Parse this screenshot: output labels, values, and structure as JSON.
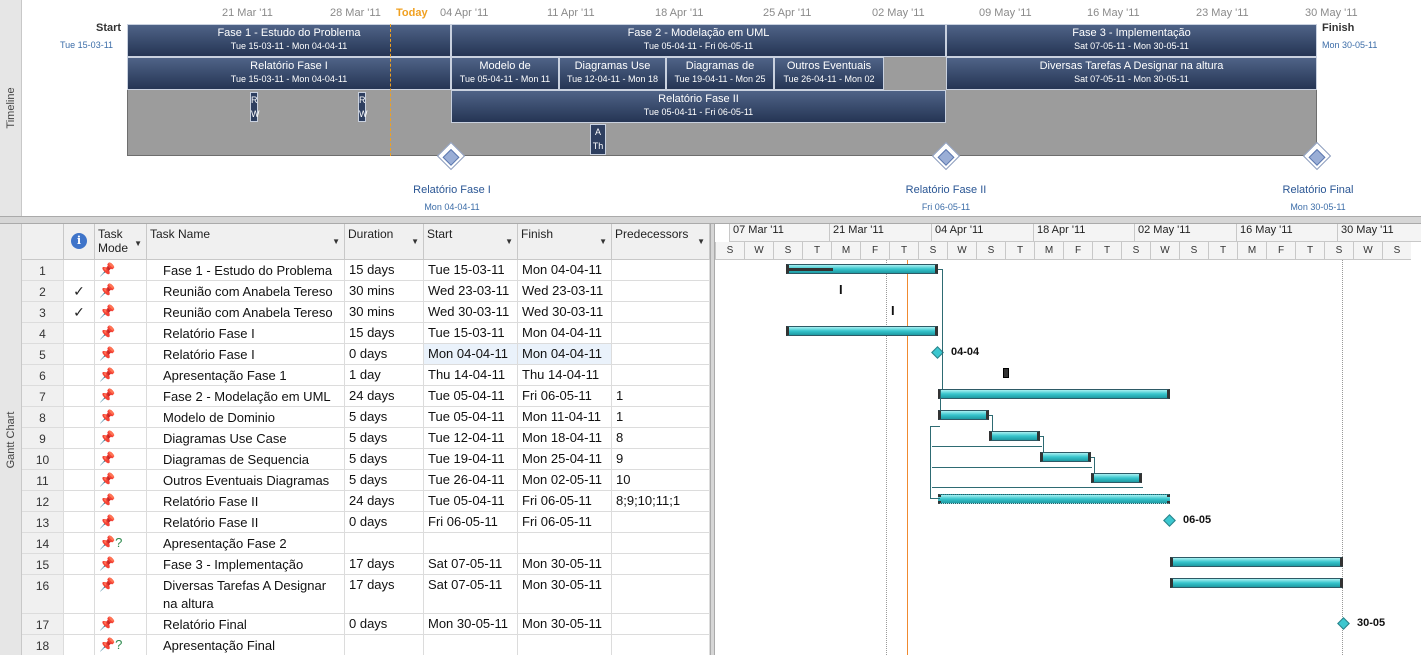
{
  "side_labels": {
    "timeline": "Timeline",
    "gantt": "Gantt Chart"
  },
  "timeline": {
    "axis": [
      "21 Mar '11",
      "28 Mar '11",
      "Today",
      "04 Apr '11",
      "11 Apr '11",
      "18 Apr '11",
      "25 Apr '11",
      "02 May '11",
      "09 May '11",
      "16 May '11",
      "23 May '11",
      "30 May '11"
    ],
    "start": {
      "label": "Start",
      "date": "Tue 15-03-11"
    },
    "finish": {
      "label": "Finish",
      "date": "Mon 30-05-11"
    },
    "bars": [
      {
        "name": "Fase 1 - Estudo do Problema",
        "dates": "Tue 15-03-11 - Mon 04-04-11"
      },
      {
        "name": "Fase 2 - Modelação em UML",
        "dates": "Tue 05-04-11 - Fri 06-05-11"
      },
      {
        "name": "Fase 3 - Implementação",
        "dates": "Sat 07-05-11 - Mon 30-05-11"
      },
      {
        "name": "Relatório Fase I",
        "dates": "Tue 15-03-11 - Mon 04-04-11"
      },
      {
        "name": "Modelo de",
        "dates": "Tue 05-04-11 - Mon 11"
      },
      {
        "name": "Diagramas Use",
        "dates": "Tue 12-04-11 - Mon 18"
      },
      {
        "name": "Diagramas de",
        "dates": "Tue 19-04-11 - Mon 25"
      },
      {
        "name": "Outros Eventuais",
        "dates": "Tue 26-04-11 - Mon 02"
      },
      {
        "name": "Diversas Tarefas A Designar na altura",
        "dates": "Sat 07-05-11 - Mon 30-05-11"
      },
      {
        "name": "Relatório Fase II",
        "dates": "Tue 05-04-11 - Fri 06-05-11"
      }
    ],
    "small_tasks": [
      {
        "t1": "R",
        "t2": "W"
      },
      {
        "t1": "R",
        "t2": "W"
      },
      {
        "t1": "A",
        "t2": "Th"
      }
    ],
    "milestones": [
      {
        "name": "Relatório Fase I",
        "date": "Mon 04-04-11"
      },
      {
        "name": "Relatório Fase II",
        "date": "Fri 06-05-11"
      },
      {
        "name": "Relatório Final",
        "date": "Mon 30-05-11"
      }
    ]
  },
  "table": {
    "headers": {
      "indicators": "i",
      "mode": "Task Mode",
      "name": "Task Name",
      "duration": "Duration",
      "start": "Start",
      "finish": "Finish",
      "predecessors": "Predecessors"
    },
    "rows": [
      {
        "id": "1",
        "check": "",
        "mode": "auto",
        "name": "Fase 1 - Estudo do Problema",
        "duration": "15 days",
        "start": "Tue 15-03-11",
        "finish": "Mon 04-04-11",
        "pred": ""
      },
      {
        "id": "2",
        "check": "✓",
        "mode": "auto",
        "name": "Reunião com Anabela Tereso",
        "duration": "30 mins",
        "start": "Wed 23-03-11",
        "finish": "Wed 23-03-11",
        "pred": ""
      },
      {
        "id": "3",
        "check": "✓",
        "mode": "auto",
        "name": "Reunião com Anabela Tereso",
        "duration": "30 mins",
        "start": "Wed 30-03-11",
        "finish": "Wed 30-03-11",
        "pred": ""
      },
      {
        "id": "4",
        "check": "",
        "mode": "auto",
        "name": "Relatório Fase I",
        "duration": "15 days",
        "start": "Tue 15-03-11",
        "finish": "Mon 04-04-11",
        "pred": ""
      },
      {
        "id": "5",
        "check": "",
        "mode": "auto",
        "name": "Relatório Fase I",
        "duration": "0 days",
        "start": "Mon 04-04-11",
        "finish": "Mon 04-04-11",
        "pred": ""
      },
      {
        "id": "6",
        "check": "",
        "mode": "auto",
        "name": "Apresentação Fase 1",
        "duration": "1 day",
        "start": "Thu 14-04-11",
        "finish": "Thu 14-04-11",
        "pred": ""
      },
      {
        "id": "7",
        "check": "",
        "mode": "auto",
        "name": "Fase 2 - Modelação em UML",
        "duration": "24 days",
        "start": "Tue 05-04-11",
        "finish": "Fri 06-05-11",
        "pred": "1"
      },
      {
        "id": "8",
        "check": "",
        "mode": "auto",
        "name": "Modelo de Dominio",
        "duration": "5 days",
        "start": "Tue 05-04-11",
        "finish": "Mon 11-04-11",
        "pred": "1"
      },
      {
        "id": "9",
        "check": "",
        "mode": "auto",
        "name": "Diagramas Use Case",
        "duration": "5 days",
        "start": "Tue 12-04-11",
        "finish": "Mon 18-04-11",
        "pred": "8"
      },
      {
        "id": "10",
        "check": "",
        "mode": "auto",
        "name": "Diagramas de Sequencia",
        "duration": "5 days",
        "start": "Tue 19-04-11",
        "finish": "Mon 25-04-11",
        "pred": "9"
      },
      {
        "id": "11",
        "check": "",
        "mode": "auto",
        "name": "Outros Eventuais Diagramas",
        "duration": "5 days",
        "start": "Tue 26-04-11",
        "finish": "Mon 02-05-11",
        "pred": "10"
      },
      {
        "id": "12",
        "check": "",
        "mode": "auto",
        "name": "Relatório Fase II",
        "duration": "24 days",
        "start": "Tue 05-04-11",
        "finish": "Fri 06-05-11",
        "pred": "8;9;10;11;1"
      },
      {
        "id": "13",
        "check": "",
        "mode": "auto",
        "name": "Relatório Fase II",
        "duration": "0 days",
        "start": "Fri 06-05-11",
        "finish": "Fri 06-05-11",
        "pred": ""
      },
      {
        "id": "14",
        "check": "",
        "mode": "manual",
        "name": "Apresentação Fase 2",
        "duration": "",
        "start": "",
        "finish": "",
        "pred": ""
      },
      {
        "id": "15",
        "check": "",
        "mode": "auto",
        "name": "Fase 3 - Implementação",
        "duration": "17 days",
        "start": "Sat 07-05-11",
        "finish": "Mon 30-05-11",
        "pred": ""
      },
      {
        "id": "16",
        "check": "",
        "mode": "auto",
        "name": "Diversas Tarefas A Designar na altura",
        "duration": "17 days",
        "start": "Sat 07-05-11",
        "finish": "Mon 30-05-11",
        "pred": ""
      },
      {
        "id": "17",
        "check": "",
        "mode": "auto",
        "name": "Relatório Final",
        "duration": "0 days",
        "start": "Mon 30-05-11",
        "finish": "Mon 30-05-11",
        "pred": ""
      },
      {
        "id": "18",
        "check": "",
        "mode": "manual",
        "name": "Apresentação Final",
        "duration": "",
        "start": "",
        "finish": "",
        "pred": ""
      }
    ]
  },
  "gantt": {
    "weeks": [
      "07 Mar '11",
      "21 Mar '11",
      "04 Apr '11",
      "18 Apr '11",
      "02 May '11",
      "16 May '11",
      "30 May '11"
    ],
    "days": [
      "S",
      "W",
      "S",
      "T",
      "M",
      "F",
      "T",
      "S",
      "W",
      "S",
      "T",
      "M",
      "F",
      "T",
      "S",
      "W",
      "S",
      "T",
      "M",
      "F",
      "T",
      "S",
      "W",
      "S"
    ],
    "milestone_labels": [
      "04-04",
      "06-05",
      "30-05"
    ]
  },
  "colors": {
    "bar": "#36c4cc",
    "timeline_bar": "#253554",
    "today": "#f08a30"
  }
}
